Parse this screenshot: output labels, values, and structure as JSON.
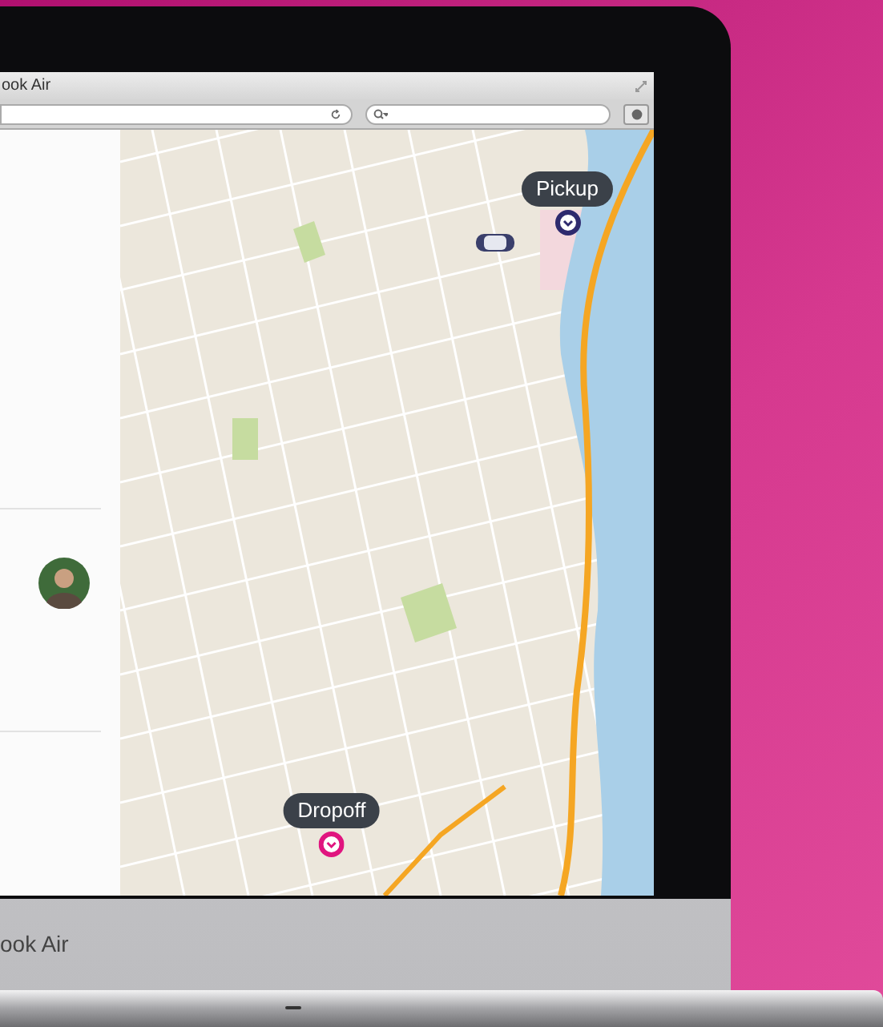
{
  "browser": {
    "title": "ook Air"
  },
  "map": {
    "markers": [
      {
        "kind": "pickup",
        "label": "Pickup",
        "color": "#2e2a6e"
      },
      {
        "kind": "dropoff",
        "label": "Dropoff",
        "color": "#e0157f"
      }
    ]
  },
  "laptop": {
    "label": "ook Air"
  }
}
